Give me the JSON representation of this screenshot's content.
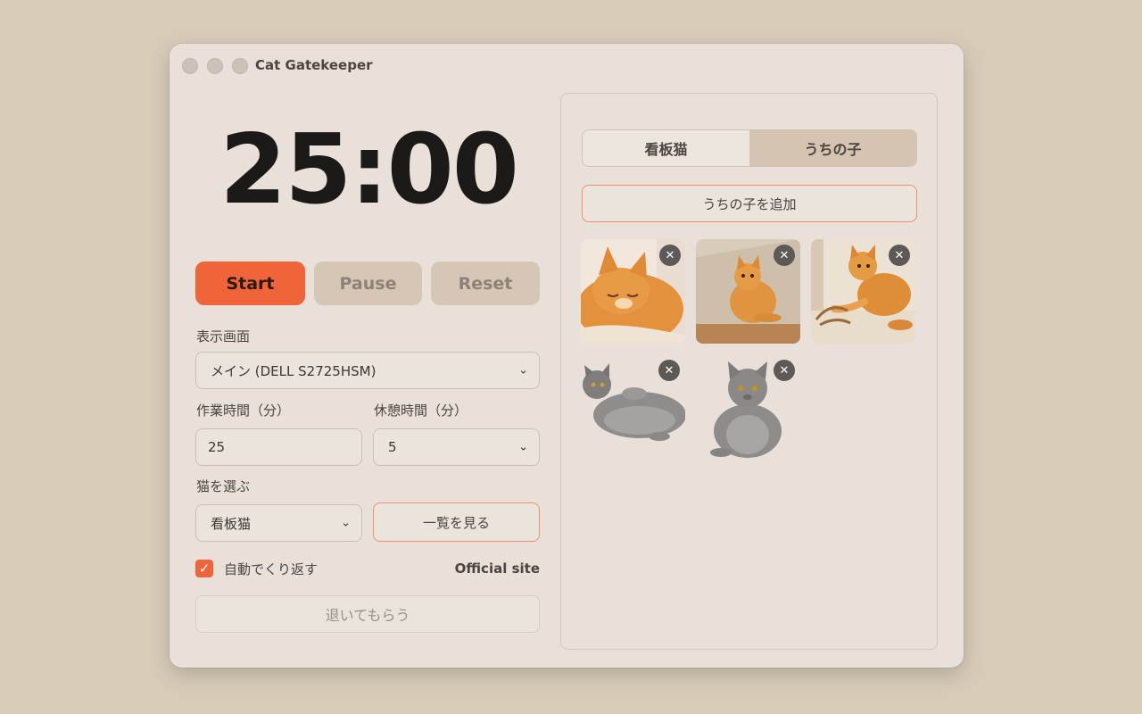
{
  "window": {
    "title": "Cat Gatekeeper"
  },
  "timer": {
    "display": "25:00"
  },
  "controls": {
    "start": "Start",
    "pause": "Pause",
    "reset": "Reset"
  },
  "display": {
    "label": "表示画面",
    "value": "メイン (DELL S2725HSM)"
  },
  "work": {
    "label": "作業時間（分）",
    "value": "25"
  },
  "break": {
    "label": "休憩時間（分）",
    "value": "5"
  },
  "cat_select": {
    "label": "猫を選ぶ",
    "value": "看板猫",
    "view_list": "一覧を見る"
  },
  "repeat": {
    "label": "自動でくり返す",
    "checked": true
  },
  "official_site": "Official site",
  "leave_button": "退いてもらう",
  "panel": {
    "tabs": [
      {
        "label": "看板猫",
        "active": false
      },
      {
        "label": "うちの子",
        "active": true
      }
    ],
    "add_button": "うちの子を追加",
    "photos": [
      {
        "name": "orange-cat-sleeping"
      },
      {
        "name": "orange-cat-on-rug"
      },
      {
        "name": "orange-cat-playing"
      },
      {
        "name": "gray-cat-lying"
      },
      {
        "name": "gray-cat-sitting"
      }
    ]
  },
  "colors": {
    "accent": "#f0643a",
    "window_bg": "#e9e1d9",
    "desktop_bg": "#d8ccb9",
    "muted_button": "#d6c6b5"
  },
  "icons": {
    "delete": "close-icon",
    "checkbox": "check-icon",
    "select": "chevron-down-icon"
  }
}
